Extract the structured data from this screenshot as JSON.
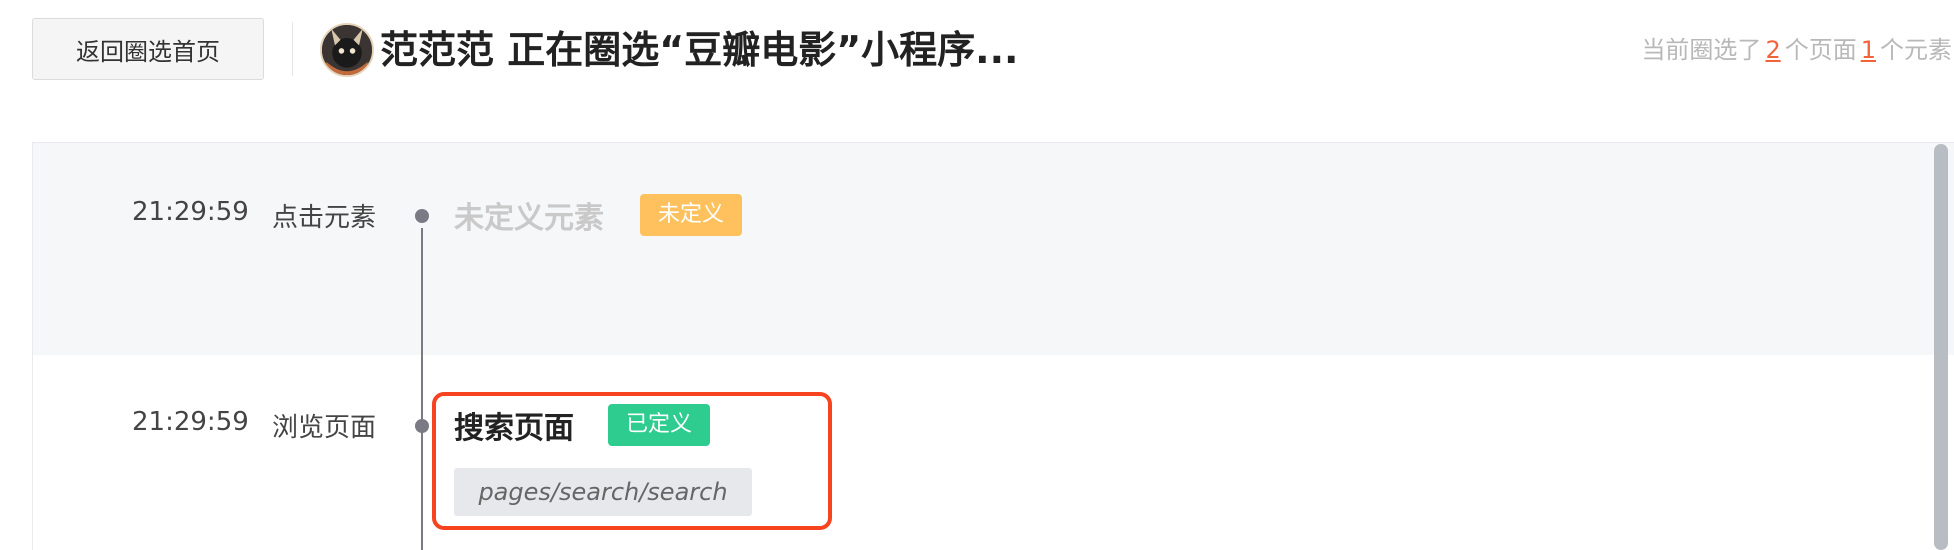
{
  "header": {
    "back_button_label": "返回圈选首页",
    "title": "范范范 正在圈选“豆瓣电影”小程序...",
    "stats": {
      "prefix": "当前圈选了",
      "pages_count": "2",
      "pages_label": "个页面",
      "elements_count": "1",
      "elements_label": "个元素"
    }
  },
  "events": [
    {
      "time": "21:29:59",
      "action": "点击元素",
      "name": "未定义元素",
      "badge": "未定义"
    },
    {
      "time": "21:29:59",
      "action": "浏览页面",
      "name": "搜索页面",
      "badge": "已定义",
      "path": "pages/search/search"
    }
  ],
  "colors": {
    "accent": "#f0643c",
    "highlight_border": "#f5441f",
    "badge_undefined": "#ffc15e",
    "badge_defined": "#2ecc8f"
  },
  "icons": {
    "avatar": "user-avatar"
  }
}
